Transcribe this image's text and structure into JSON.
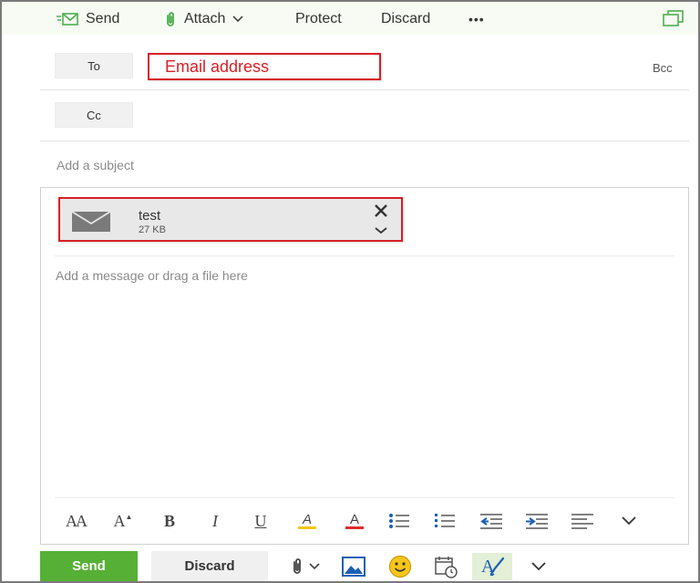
{
  "toolbar": {
    "send_label": "Send",
    "attach_label": "Attach",
    "protect_label": "Protect",
    "discard_label": "Discard",
    "more_label": "•••"
  },
  "recipients": {
    "to_label": "To",
    "to_value": "Email address",
    "cc_label": "Cc",
    "bcc_label": "Bcc"
  },
  "subject": {
    "placeholder": "Add a subject"
  },
  "attachment": {
    "name": "test",
    "size": "27 KB"
  },
  "message": {
    "placeholder": "Add a message or drag a file here"
  },
  "format_bar": {
    "font_size_label": "AA",
    "grow_label": "A",
    "bold_label": "B",
    "italic_label": "I",
    "underline_label": "U",
    "highlight_label": "A",
    "font_color_label": "A"
  },
  "actions": {
    "send_label": "Send",
    "discard_label": "Discard"
  },
  "colors": {
    "accent_green": "#57b036",
    "annotation_red": "#d81f26",
    "toolbar_green_icon": "#4caf50"
  },
  "icons": [
    "send-icon",
    "paperclip-icon",
    "chevron-down-icon",
    "more-icon",
    "popout-icon",
    "envelope-icon",
    "close-icon",
    "image-icon",
    "emoji-icon",
    "calendar-icon",
    "editor-icon"
  ]
}
